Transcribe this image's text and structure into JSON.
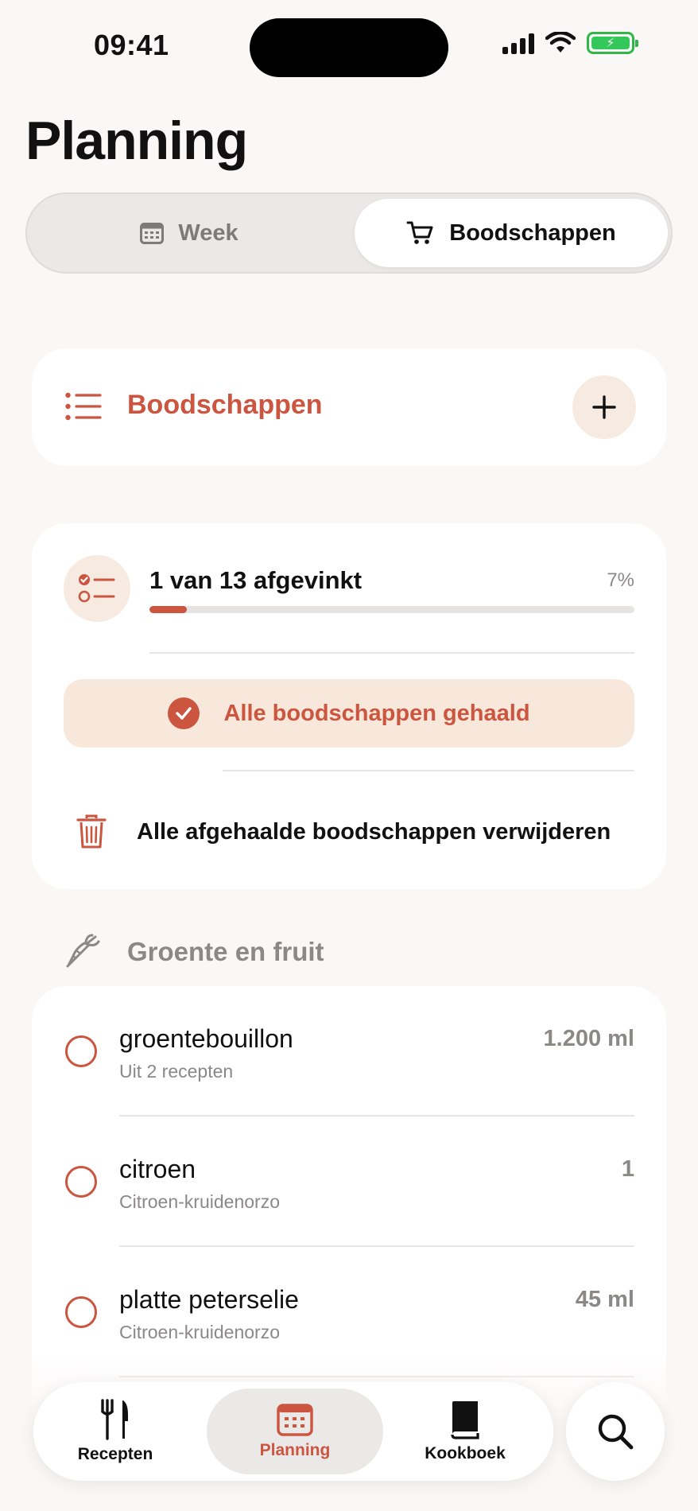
{
  "status_bar": {
    "time": "09:41"
  },
  "header": {
    "title": "Planning"
  },
  "segmented": {
    "week_label": "Week",
    "shopping_label": "Boodschappen",
    "selected": "Boodschappen"
  },
  "list_header": {
    "label": "Boodschappen"
  },
  "progress": {
    "text": "1 van 13 afgevinkt",
    "percent_label": "7%",
    "checked": 1,
    "total": 13,
    "fraction": 0.077
  },
  "actions": {
    "all_done_label": "Alle boodschappen gehaald",
    "delete_label": "Alle afgehaalde boodschappen verwijderen"
  },
  "section": {
    "label": "Groente en fruit",
    "icon": "carrot-icon"
  },
  "items": [
    {
      "name": "groentebouillon",
      "source": "Uit 2 recepten",
      "quantity": "1.200 ml",
      "checked": false
    },
    {
      "name": "citroen",
      "source": "Citroen-kruidenorzo",
      "quantity": "1",
      "checked": false
    },
    {
      "name": "platte peterselie",
      "source": "Citroen-kruidenorzo",
      "quantity": "45 ml",
      "checked": false
    }
  ],
  "tabbar": {
    "recepten": "Recepten",
    "planning": "Planning",
    "kookboek": "Kookboek",
    "selected": "Planning"
  },
  "colors": {
    "accent": "#cc5540",
    "accent_soft": "#f8e8dc",
    "background": "#faf8f6",
    "battery": "#34c759"
  }
}
